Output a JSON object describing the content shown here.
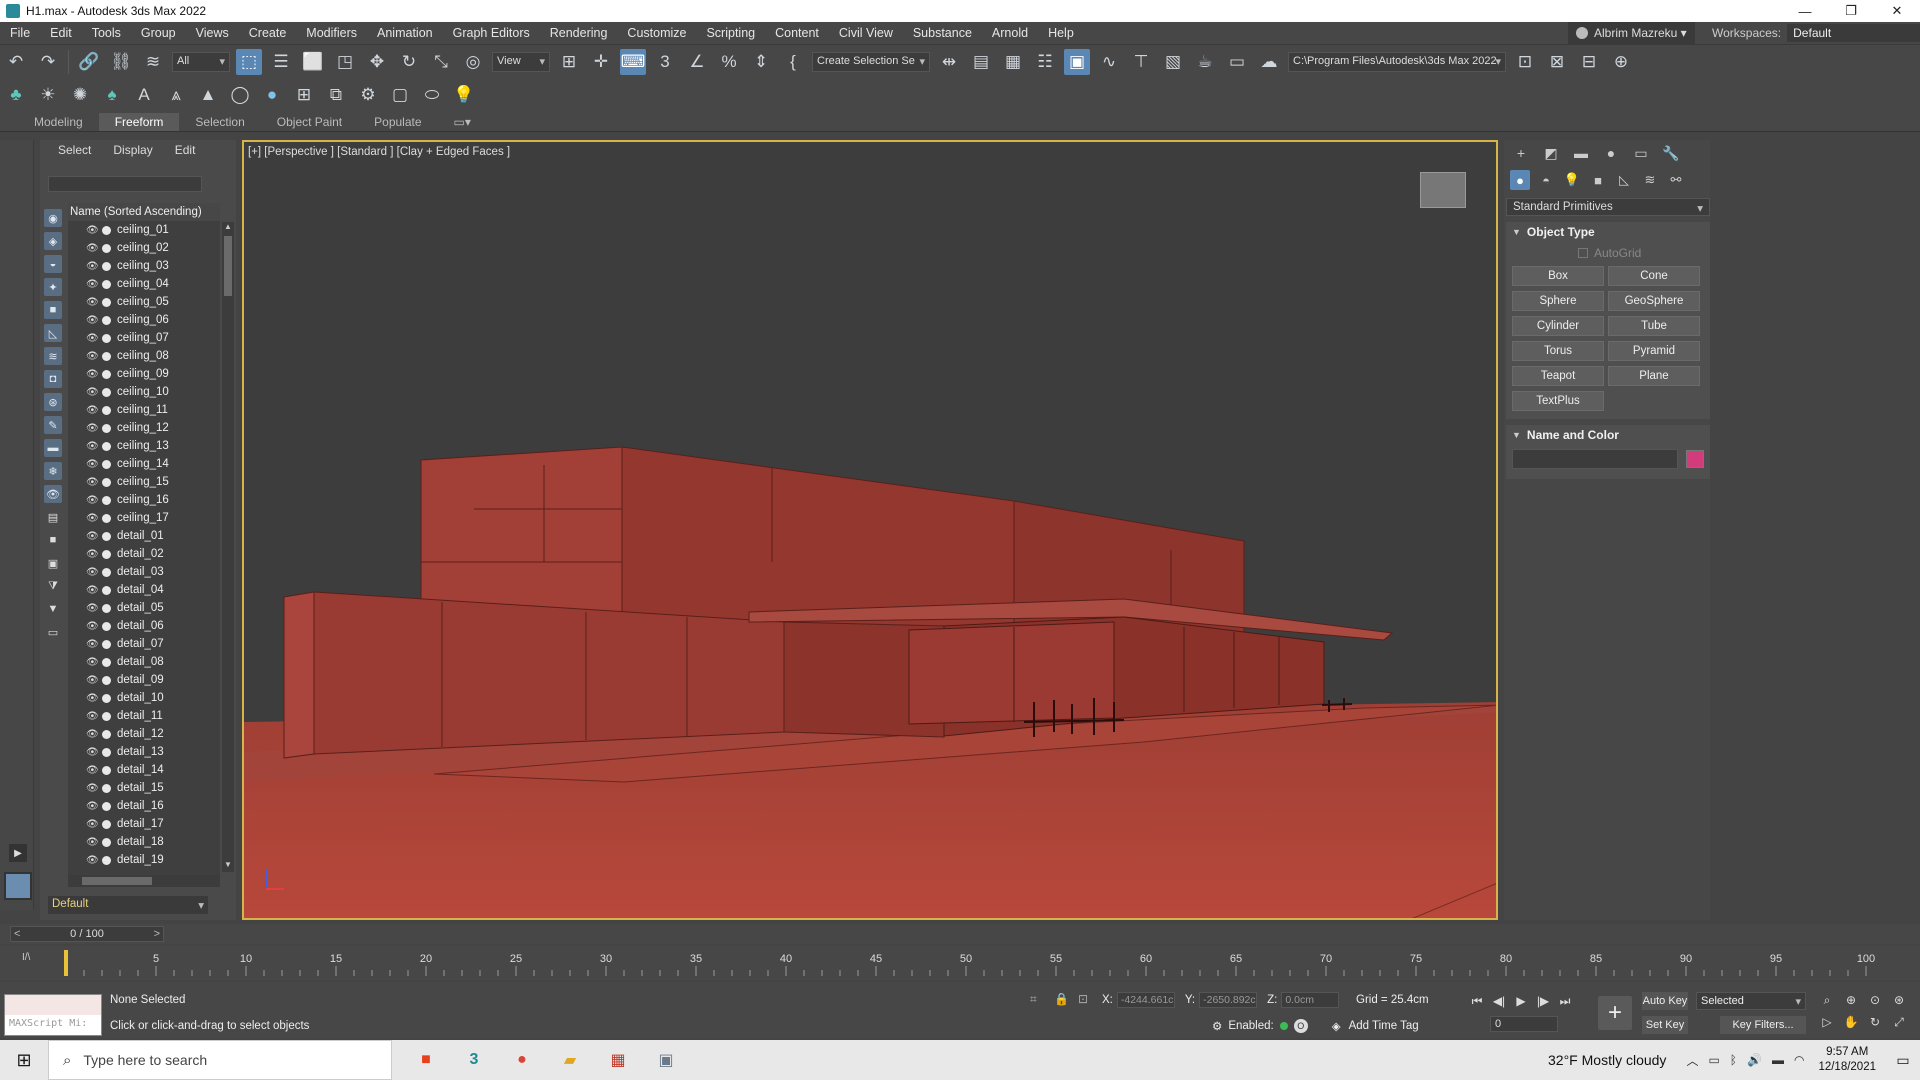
{
  "window": {
    "title": "H1.max - Autodesk 3ds Max 2022",
    "controls": [
      "—",
      "❐",
      "✕"
    ]
  },
  "menu": {
    "items": [
      "File",
      "Edit",
      "Tools",
      "Group",
      "Views",
      "Create",
      "Modifiers",
      "Animation",
      "Graph Editors",
      "Rendering",
      "Customize",
      "Scripting",
      "Content",
      "Civil View",
      "Substance",
      "Arnold",
      "Help"
    ],
    "user": "Albrim Mazreku ▾",
    "workspaces_label": "Workspaces:",
    "workspaces_value": "Default"
  },
  "toolbar": {
    "filter_value": "All",
    "refcoord_value": "View",
    "selection_set": "Create Selection Se",
    "project_path": "C:\\Program Files\\Autodesk\\3ds Max 2022"
  },
  "ribbon": {
    "tabs": [
      "Modeling",
      "Freeform",
      "Selection",
      "Object Paint",
      "Populate"
    ],
    "active": "Freeform"
  },
  "explorer": {
    "tabs": [
      "Select",
      "Display",
      "Edit"
    ],
    "column_header": "Name (Sorted Ascending)",
    "items": [
      "ceiling_01",
      "ceiling_02",
      "ceiling_03",
      "ceiling_04",
      "ceiling_05",
      "ceiling_06",
      "ceiling_07",
      "ceiling_08",
      "ceiling_09",
      "ceiling_10",
      "ceiling_11",
      "ceiling_12",
      "ceiling_13",
      "ceiling_14",
      "ceiling_15",
      "ceiling_16",
      "ceiling_17",
      "detail_01",
      "detail_02",
      "detail_03",
      "detail_04",
      "detail_05",
      "detail_06",
      "detail_07",
      "detail_08",
      "detail_09",
      "detail_10",
      "detail_11",
      "detail_12",
      "detail_13",
      "detail_14",
      "detail_15",
      "detail_16",
      "detail_17",
      "detail_18",
      "detail_19"
    ],
    "layer": "Default"
  },
  "viewport": {
    "label": "[+] [Perspective ] [Standard ] [Clay + Edged Faces ]"
  },
  "command_panel": {
    "category": "Standard Primitives",
    "object_type_title": "Object Type",
    "autogrid": "AutoGrid",
    "buttons": [
      "Box",
      "Cone",
      "Sphere",
      "GeoSphere",
      "Cylinder",
      "Tube",
      "Torus",
      "Pyramid",
      "Teapot",
      "Plane",
      "TextPlus"
    ],
    "name_color_title": "Name and Color",
    "object_color": "#d23c7a"
  },
  "timeline": {
    "slider_text": "0 / 100",
    "ticks": [
      "5",
      "10",
      "15",
      "20",
      "25",
      "30",
      "35",
      "40",
      "45",
      "50",
      "55",
      "60",
      "65",
      "70",
      "75",
      "80",
      "85",
      "90",
      "95",
      "100"
    ]
  },
  "status": {
    "maxscript": "MAXScript Mi:",
    "selection": "None Selected",
    "hint": "Click or click-and-drag to select objects",
    "x_label": "X:",
    "x_value": "-4244.661c",
    "y_label": "Y:",
    "y_value": "-2650.892c",
    "z_label": "Z:",
    "z_value": "0.0cm",
    "grid": "Grid = 25.4cm",
    "enabled": "Enabled:",
    "add_time_tag": "Add Time Tag",
    "frame": "0",
    "auto_key": "Auto Key",
    "set_key": "Set Key",
    "key_mode": "Selected",
    "key_filters": "Key Filters..."
  },
  "taskbar": {
    "search_placeholder": "Type here to search",
    "weather": "32°F  Mostly cloudy",
    "time": "9:57 AM",
    "date": "12/18/2021"
  }
}
